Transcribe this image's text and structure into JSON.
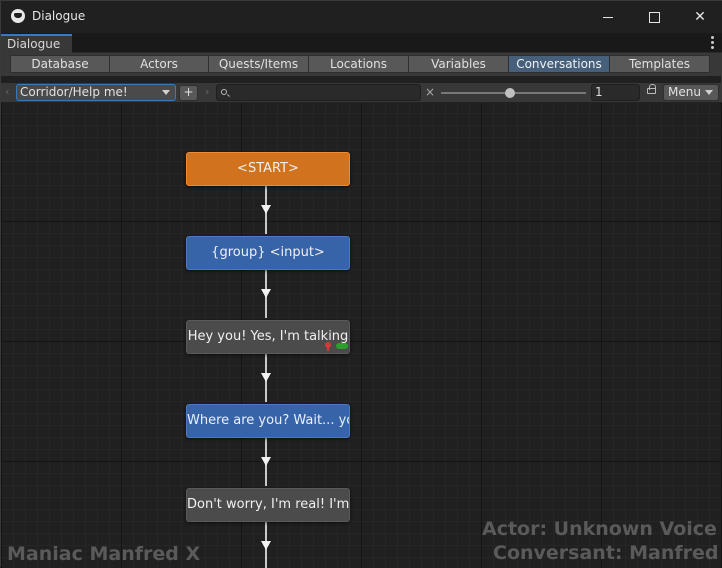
{
  "window": {
    "title": "Dialogue"
  },
  "doc_tab": {
    "label": "Dialogue"
  },
  "main_tabs": [
    {
      "label": "Database"
    },
    {
      "label": "Actors"
    },
    {
      "label": "Quests/Items"
    },
    {
      "label": "Locations"
    },
    {
      "label": "Variables"
    },
    {
      "label": "Conversations",
      "active": true
    },
    {
      "label": "Templates"
    }
  ],
  "toolbar": {
    "conversation_select": "Corridor/Help me!",
    "add_label": "+",
    "search_value": "",
    "clear_label": "×",
    "zoom_value": "1",
    "zoom_slider_fraction": 0.45,
    "menu_label": "Menu"
  },
  "nodes": [
    {
      "text": "<START>",
      "color": "#d0721e"
    },
    {
      "text": "{group} <input>",
      "color": "#3764a8"
    },
    {
      "text": "Hey you! Yes, I'm talking",
      "color": "#4b4b4b"
    },
    {
      "text": "Where are you? Wait... you",
      "color": "#3764a8"
    },
    {
      "text": "Don't worry, I'm real! I'm",
      "color": "#4b4b4b"
    }
  ],
  "overlay": {
    "actor": "Actor: Unknown Voice",
    "conversant": "Conversant: Manfred",
    "bottom_left": "Maniac Manfred X"
  }
}
